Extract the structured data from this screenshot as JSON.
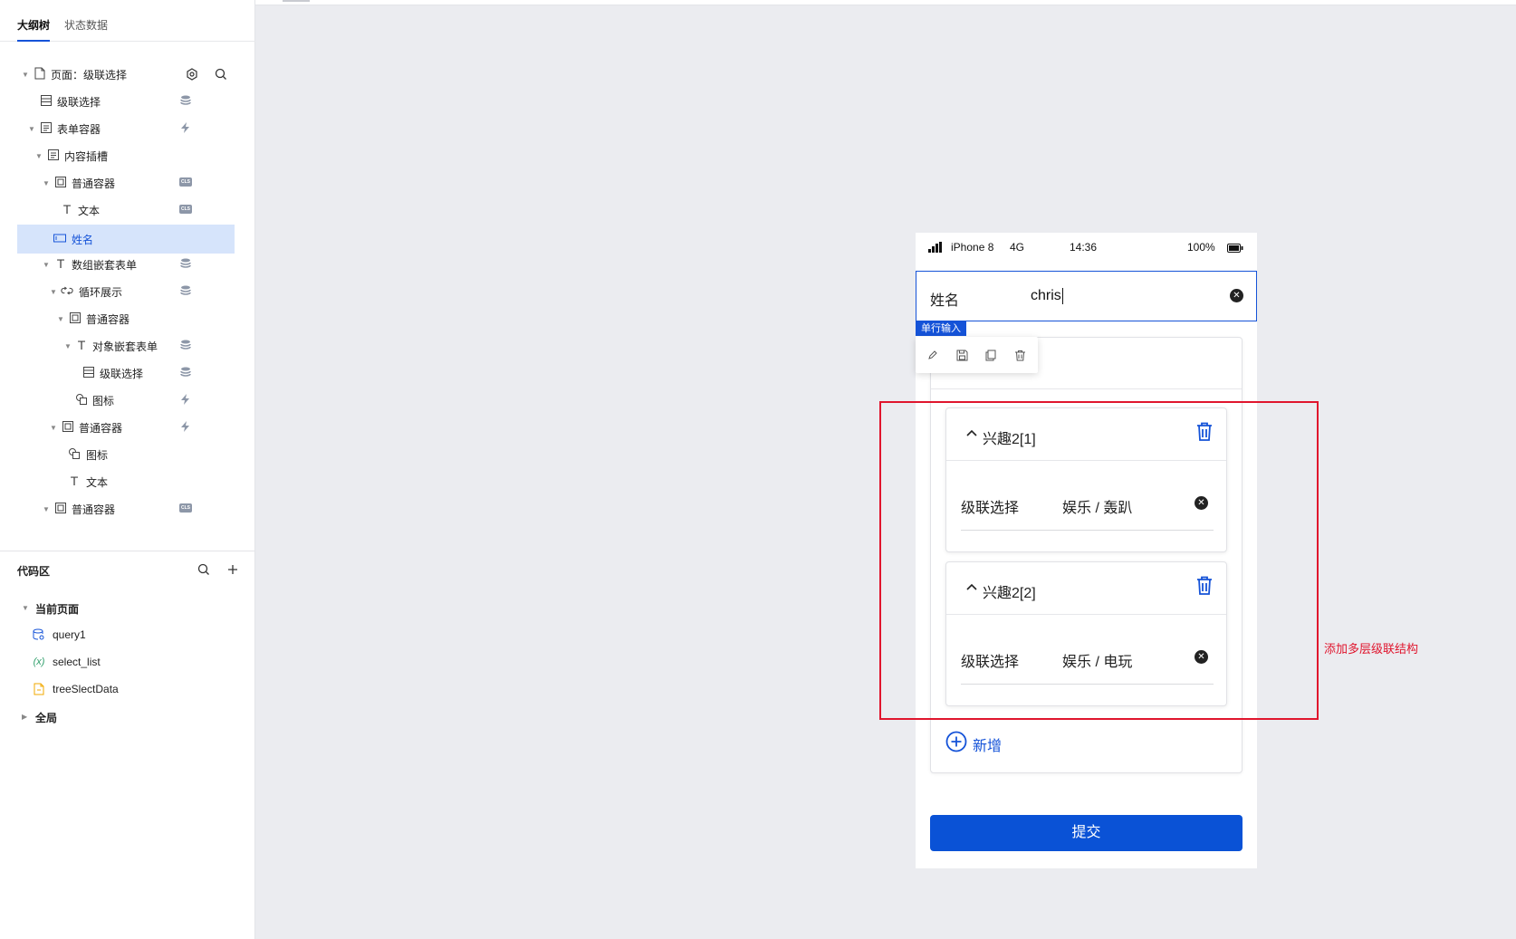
{
  "left_panel": {
    "tabs": [
      {
        "label": "大纲树",
        "active": true
      },
      {
        "label": "状态数据",
        "active": false
      }
    ],
    "tree": [
      {
        "label": "页面：级联选择",
        "icon": "page-icon",
        "right_icon": "settings-icon",
        "expanded": true
      },
      {
        "label": "级联选择",
        "icon": "list-icon",
        "right_icon": "database-icon"
      },
      {
        "label": "表单容器",
        "icon": "form-icon",
        "right_icon": "lightning-icon",
        "expanded": true
      },
      {
        "label": "内容插槽",
        "icon": "form-icon",
        "expanded": true
      },
      {
        "label": "普通容器",
        "icon": "container-icon",
        "right_icon": "cls-badge-icon",
        "expanded": true
      },
      {
        "label": "文本",
        "icon": "text-icon",
        "right_icon": "cls-badge-icon"
      },
      {
        "label": "姓名",
        "icon": "input-icon",
        "selected": true
      },
      {
        "label": "数组嵌套表单",
        "icon": "text-icon",
        "right_icon": "database-icon",
        "expanded": true
      },
      {
        "label": "循环展示",
        "icon": "loop-icon",
        "right_icon": "database-icon",
        "expanded": true
      },
      {
        "label": "普通容器",
        "icon": "container-icon",
        "expanded": true
      },
      {
        "label": "对象嵌套表单",
        "icon": "text-icon",
        "right_icon": "database-icon",
        "expanded": true
      },
      {
        "label": "级联选择",
        "icon": "list-icon",
        "right_icon": "database-icon"
      },
      {
        "label": "图标",
        "icon": "shapes-icon",
        "right_icon": "lightning-icon"
      },
      {
        "label": "普通容器",
        "icon": "container-icon",
        "right_icon": "lightning-icon",
        "expanded": true
      },
      {
        "label": "图标",
        "icon": "shapes-icon"
      },
      {
        "label": "文本",
        "icon": "text-icon"
      },
      {
        "label": "普通容器",
        "icon": "container-icon",
        "right_icon": "cls-badge-icon",
        "expanded": true
      }
    ],
    "code_area": {
      "title": "代码区",
      "groups": [
        {
          "label": "当前页面",
          "expanded": true
        },
        {
          "label": "query1",
          "icon": "query-icon"
        },
        {
          "label": "select_list",
          "icon": "variable-icon",
          "icon_text": "(x)"
        },
        {
          "label": "treeSlectData",
          "icon": "file-icon"
        },
        {
          "label": "全局",
          "expanded": false
        }
      ]
    }
  },
  "phone": {
    "status": {
      "carrier": "iPhone 8",
      "network": "4G",
      "time": "14:36",
      "battery": "100%"
    },
    "name_field": {
      "label": "姓名",
      "value": "chris",
      "tag": "单行输入"
    },
    "items": [
      {
        "title": "兴趣2[1]",
        "field_label": "级联选择",
        "field_value": "娱乐 / 轰趴"
      },
      {
        "title": "兴趣2[2]",
        "field_label": "级联选择",
        "field_value": "娱乐 / 电玩"
      }
    ],
    "add_label": "新增",
    "submit_label": "提交"
  },
  "annotation": {
    "text": "添加多层级联结构",
    "color": "#e0152d"
  },
  "colors": {
    "accent": "#1553d8",
    "submit": "#0a52d6",
    "selected_bg": "#d6e4fb",
    "canvas_bg": "#ebecf0"
  }
}
